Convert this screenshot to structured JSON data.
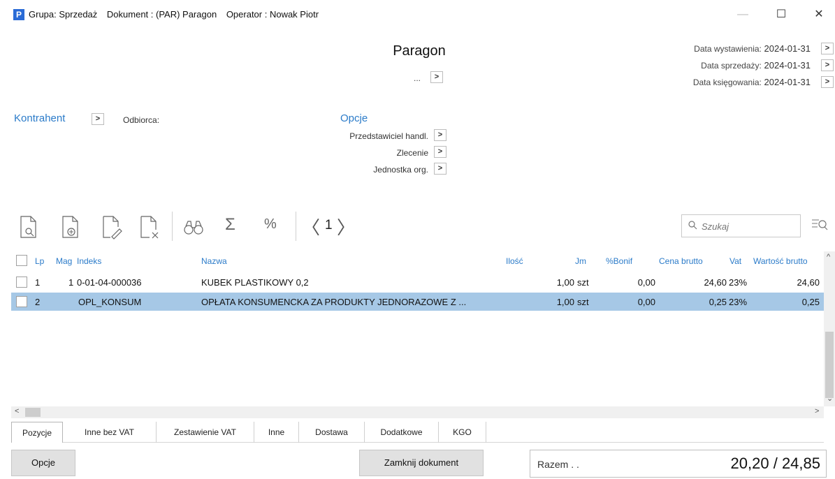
{
  "window": {
    "group": "Grupa: Sprzedaż",
    "document": "Dokument : (PAR) Paragon",
    "operator": "Operator : Nowak Piotr",
    "minimize": "—",
    "maximize": "☐",
    "close": "✕"
  },
  "header": {
    "title": "Paragon",
    "number_dots": "...",
    "dates": [
      {
        "label": "Data wystawienia:",
        "value": "2024-01-31"
      },
      {
        "label": "Data sprzedaży:",
        "value": "2024-01-31"
      },
      {
        "label": "Data księgowania:",
        "value": "2024-01-31"
      }
    ]
  },
  "contractor": {
    "label": "Kontrahent",
    "recipient_label": "Odbiorca:"
  },
  "options": {
    "label": "Opcje",
    "items": [
      "Przedstawiciel handl.",
      "Zlecenie",
      "Jednostka org."
    ]
  },
  "toolbar": {
    "icons": [
      "view-document-icon",
      "add-document-icon",
      "edit-document-icon",
      "delete-document-icon",
      "binoculars-icon",
      "sum-icon",
      "percent-icon"
    ],
    "sum_glyph": "Σ",
    "percent_glyph": "%",
    "page_number": "1",
    "prev_glyph": "〈",
    "next_glyph": "〉"
  },
  "search": {
    "placeholder": "Szukaj"
  },
  "grid": {
    "columns": [
      "Lp",
      "Mag",
      "Indeks",
      "Nazwa",
      "Ilość",
      "Jm",
      "%Bonif",
      "Cena brutto",
      "Vat",
      "Wartość brutto"
    ],
    "rows": [
      {
        "lp": "1",
        "mag": "1",
        "indeks": "0-01-04-000036",
        "nazwa": "KUBEK PLASTIKOWY 0,2",
        "ilosc": "1,00",
        "jm": "szt",
        "bonif": "0,00",
        "cena": "24,60",
        "vat": "23%",
        "wartosc": "24,60"
      },
      {
        "lp": "2",
        "mag": "",
        "indeks": "OPL_KONSUM",
        "nazwa": "OPŁATA KONSUMENCKA ZA PRODUKTY JEDNORAZOWE Z ...",
        "ilosc": "1,00",
        "jm": "szt",
        "bonif": "0,00",
        "cena": "0,25",
        "vat": "23%",
        "wartosc": "0,25"
      }
    ]
  },
  "tabs": [
    "Pozycje",
    "Inne bez VAT",
    "Zestawienie VAT",
    "Inne",
    "Dostawa",
    "Dodatkowe",
    "KGO"
  ],
  "footer": {
    "options_button": "Opcje",
    "close_doc_button": "Zamknij dokument",
    "total_label": "Razem . .",
    "total_value": "20,20 / 24,85"
  },
  "colors": {
    "accent": "#2b7bc9",
    "selected_row": "#a6c8e6"
  }
}
